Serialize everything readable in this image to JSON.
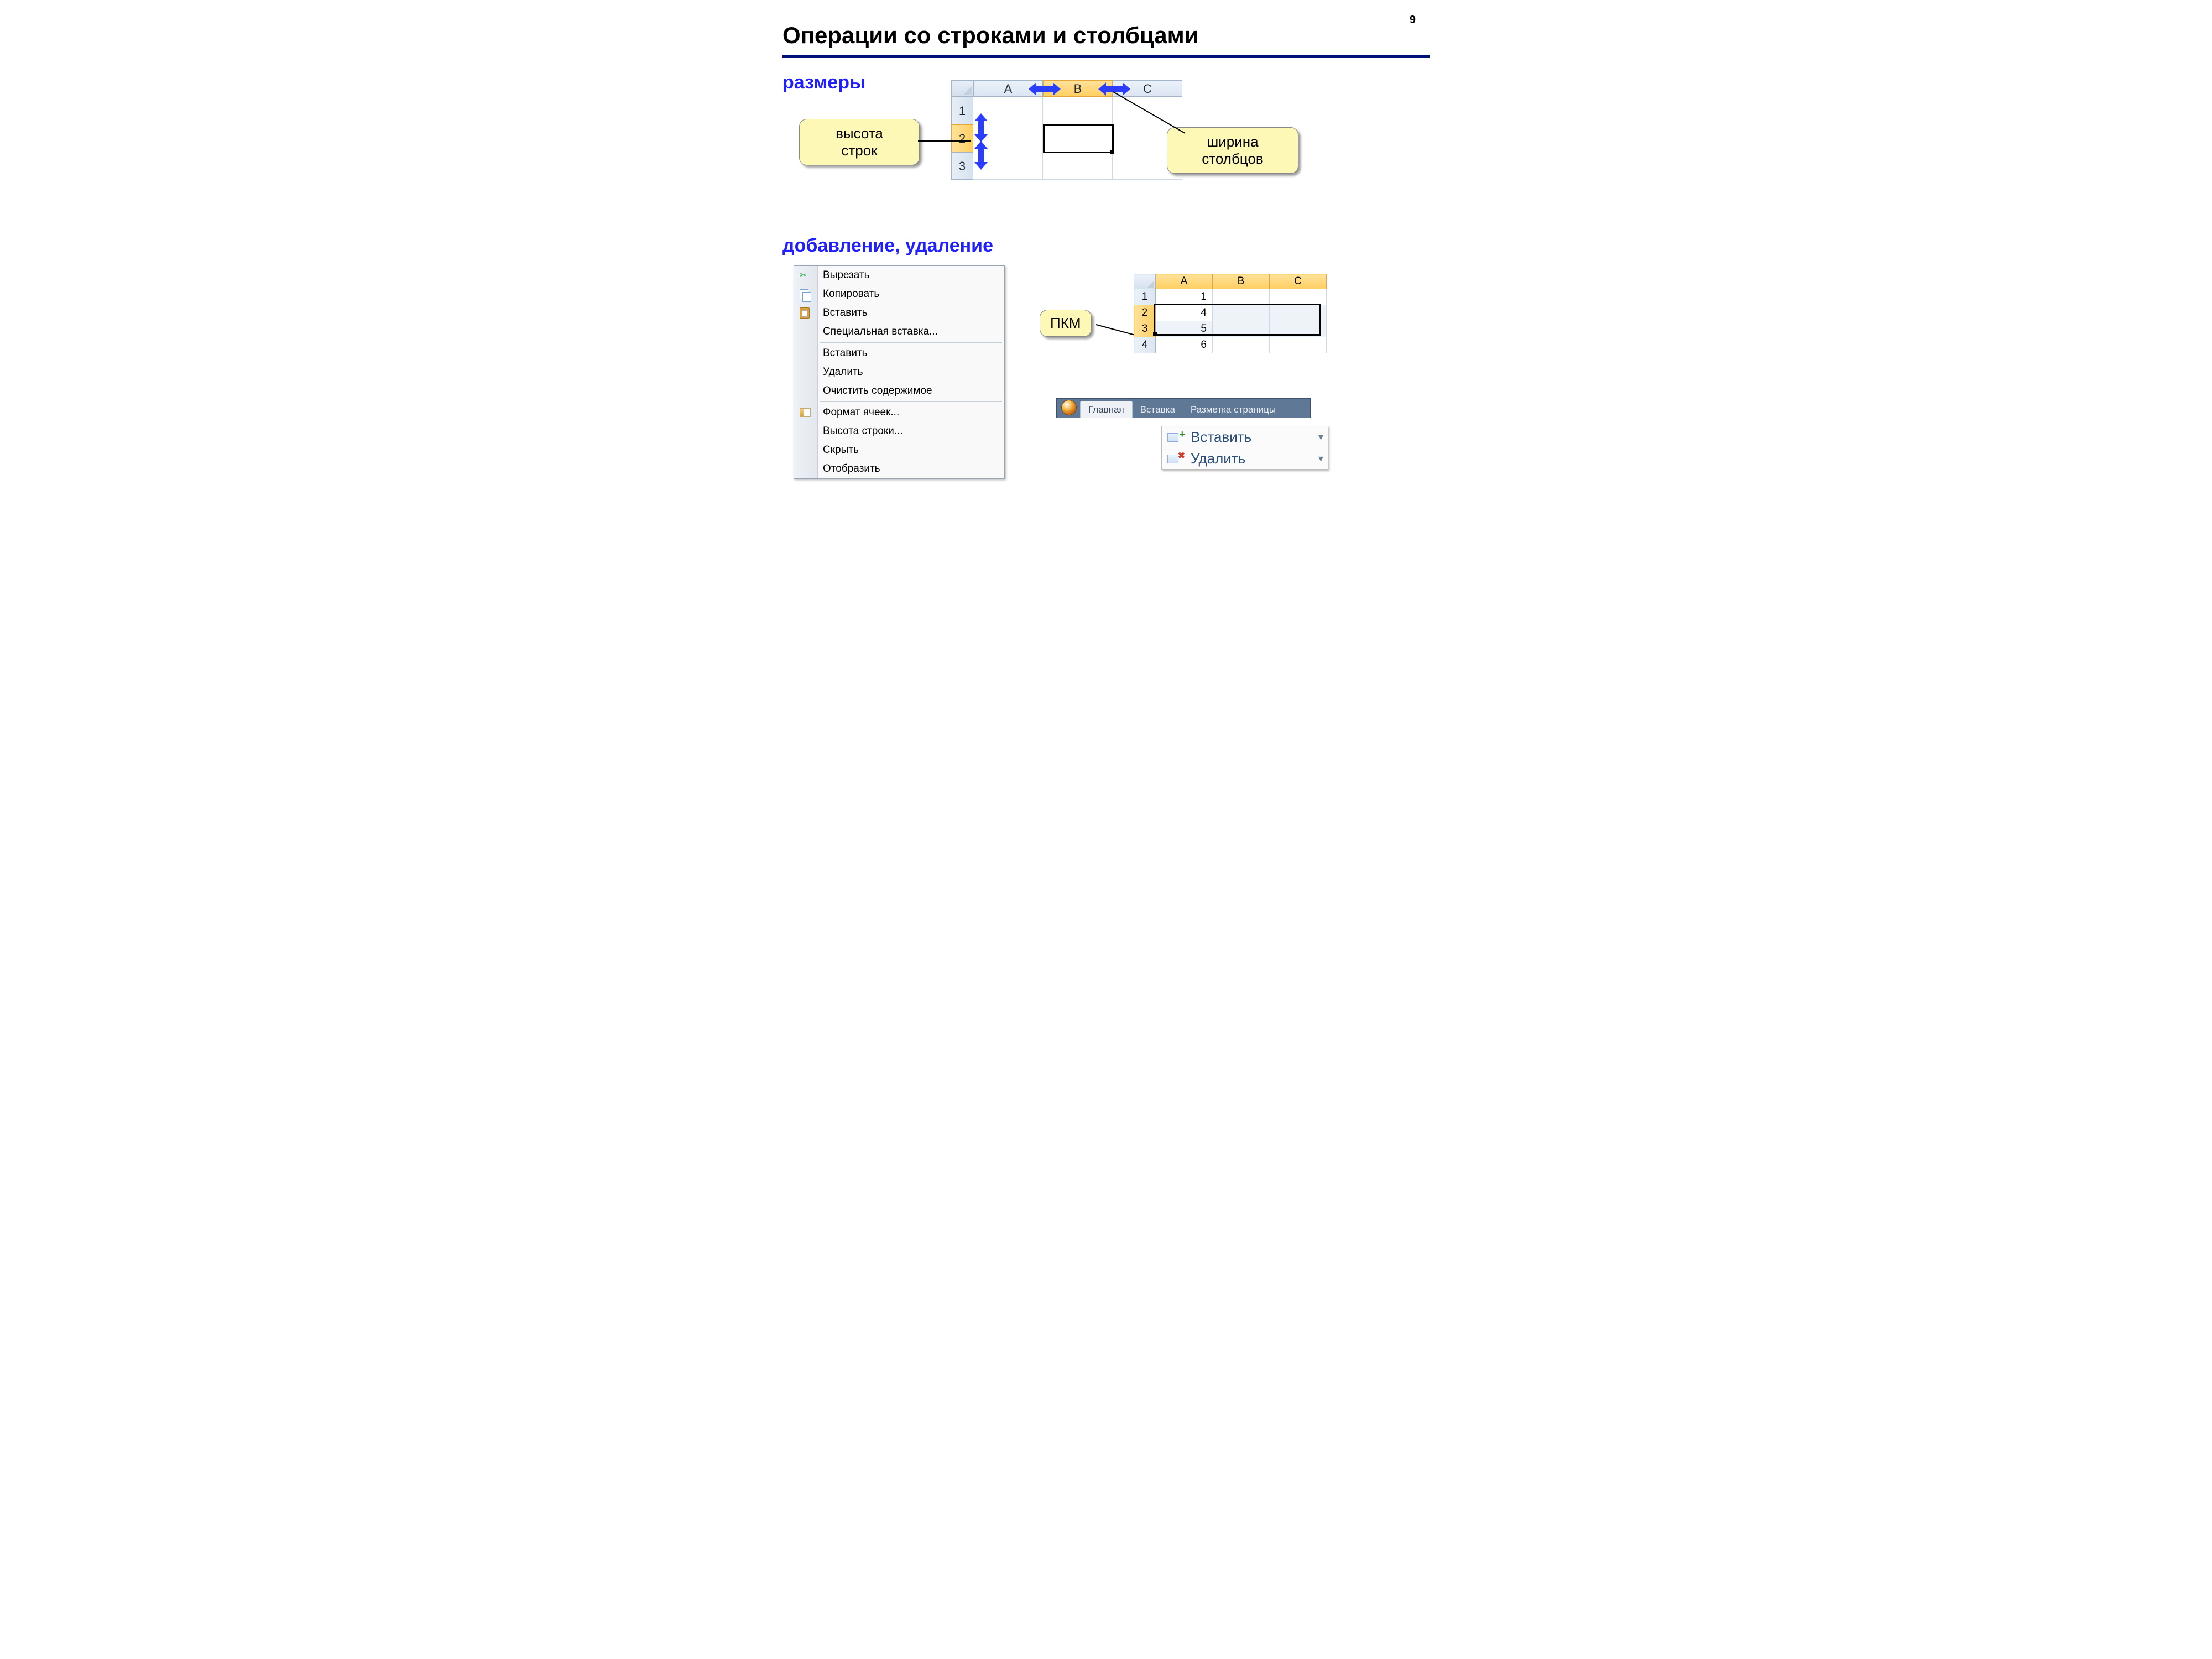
{
  "slide_number": "9",
  "title": "Операции со строками и столбцами",
  "section_sizes": "размеры",
  "section_addrem": "добавление, удаление",
  "callout_rowheight_l1": "высота",
  "callout_rowheight_l2": "строк",
  "callout_colwidth_l1": "ширина",
  "callout_colwidth_l2": "столбцов",
  "callout_rmb": "ПКМ",
  "xl1": {
    "cols": {
      "A": "A",
      "B": "B",
      "C": "C"
    },
    "rows": {
      "1": "1",
      "2": "2",
      "3": "3"
    }
  },
  "menu": {
    "cut": "Вырезать",
    "copy": "Копировать",
    "paste": "Вставить",
    "paste_special": "Специальная вставка...",
    "insert": "Вставить",
    "delete": "Удалить",
    "clear": "Очистить содержимое",
    "format": "Формат ячеек...",
    "rowheight": "Высота строки...",
    "hide": "Скрыть",
    "show": "Отобразить"
  },
  "xl2": {
    "cols": {
      "A": "A",
      "B": "B",
      "C": "C"
    },
    "rows": {
      "1": "1",
      "2": "2",
      "3": "3",
      "4": "4"
    },
    "data": {
      "A1": "1",
      "A2": "4",
      "A3": "5",
      "A4": "6"
    }
  },
  "ribbon": {
    "home": "Главная",
    "insert": "Вставка",
    "layout": "Разметка страницы"
  },
  "btns": {
    "insert": "Вставить",
    "delete": "Удалить"
  }
}
